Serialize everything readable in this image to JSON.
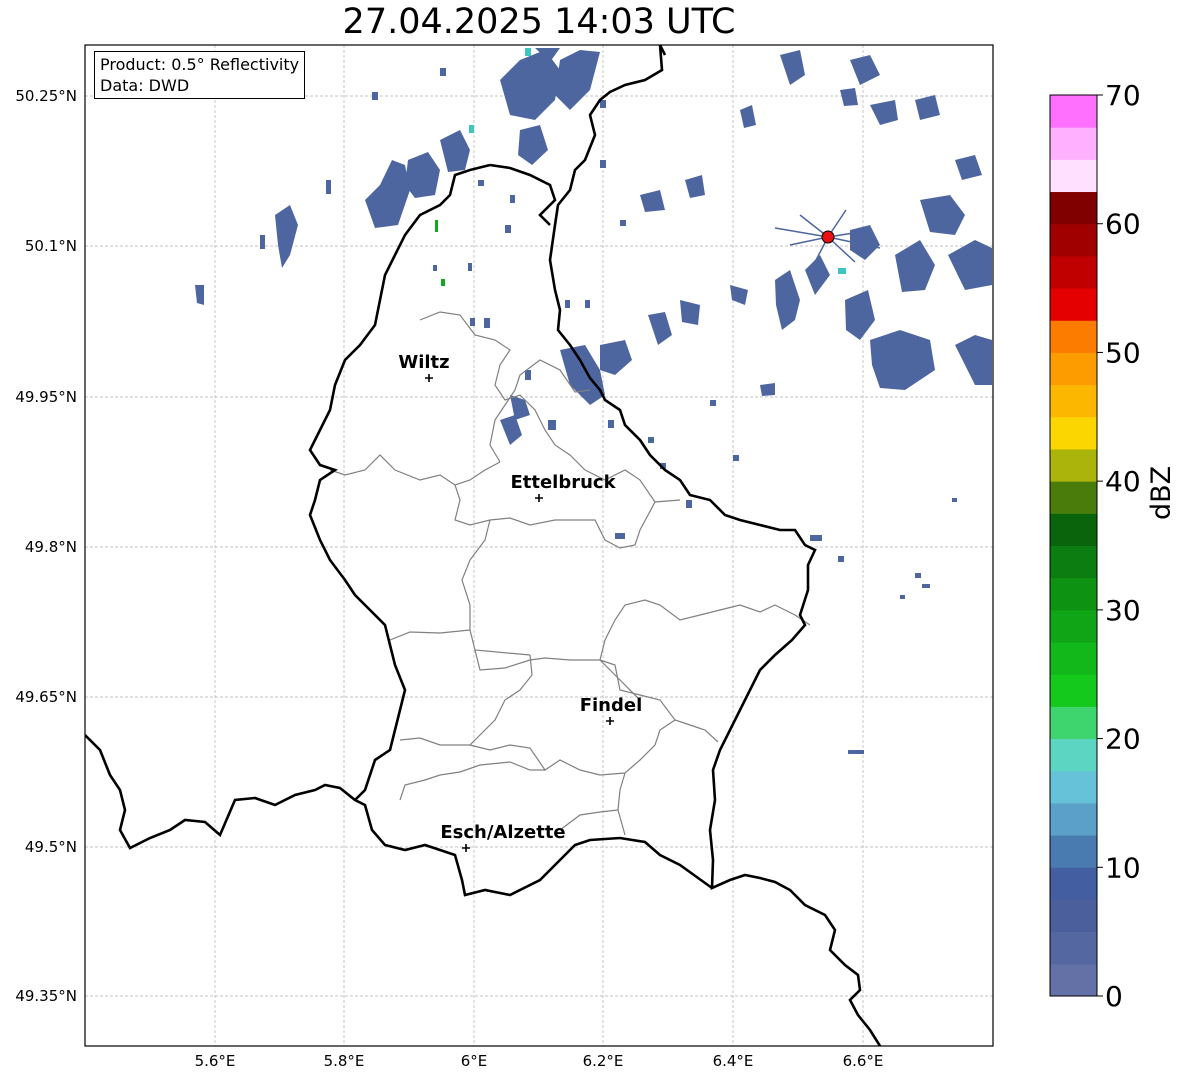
{
  "title": "27.04.2025 14:03 UTC",
  "info": {
    "product": "Product: 0.5° Reflectivity",
    "data": "Data: DWD"
  },
  "axes": {
    "lat_ticks": [
      "50.25°N",
      "50.1°N",
      "49.95°N",
      "49.8°N",
      "49.65°N",
      "49.5°N",
      "49.35°N"
    ],
    "lon_ticks": [
      "5.6°E",
      "5.8°E",
      "6°E",
      "6.2°E",
      "6.4°E",
      "6.6°E"
    ],
    "grid": true
  },
  "colorbar": {
    "label": "dBZ",
    "min": 0,
    "max": 70,
    "step": 2.5,
    "tick_labels": [
      "0",
      "10",
      "20",
      "30",
      "40",
      "50",
      "60",
      "70"
    ],
    "colors": [
      "#6371a6",
      "#5567a1",
      "#4a5f9c",
      "#435ea1",
      "#4a7bb0",
      "#5aa0c8",
      "#66c2d8",
      "#5cd6c2",
      "#3ed46e",
      "#14c81c",
      "#12b81a",
      "#10a516",
      "#0e9212",
      "#0c7d10",
      "#0a640c",
      "#4a7c0c",
      "#aab40a",
      "#fcd600",
      "#fcb800",
      "#fc9c00",
      "#fc7c00",
      "#e40000",
      "#c00000",
      "#a00000",
      "#800000",
      "#ffe0ff",
      "#ffb0ff",
      "#ff70ff",
      "#e838e8"
    ]
  },
  "cities": [
    {
      "name": "Wiltz"
    },
    {
      "name": "Ettelbruck"
    },
    {
      "name": "Findel"
    },
    {
      "name": "Esch/Alzette"
    }
  ],
  "radar_site": {
    "color": "#e81010"
  }
}
